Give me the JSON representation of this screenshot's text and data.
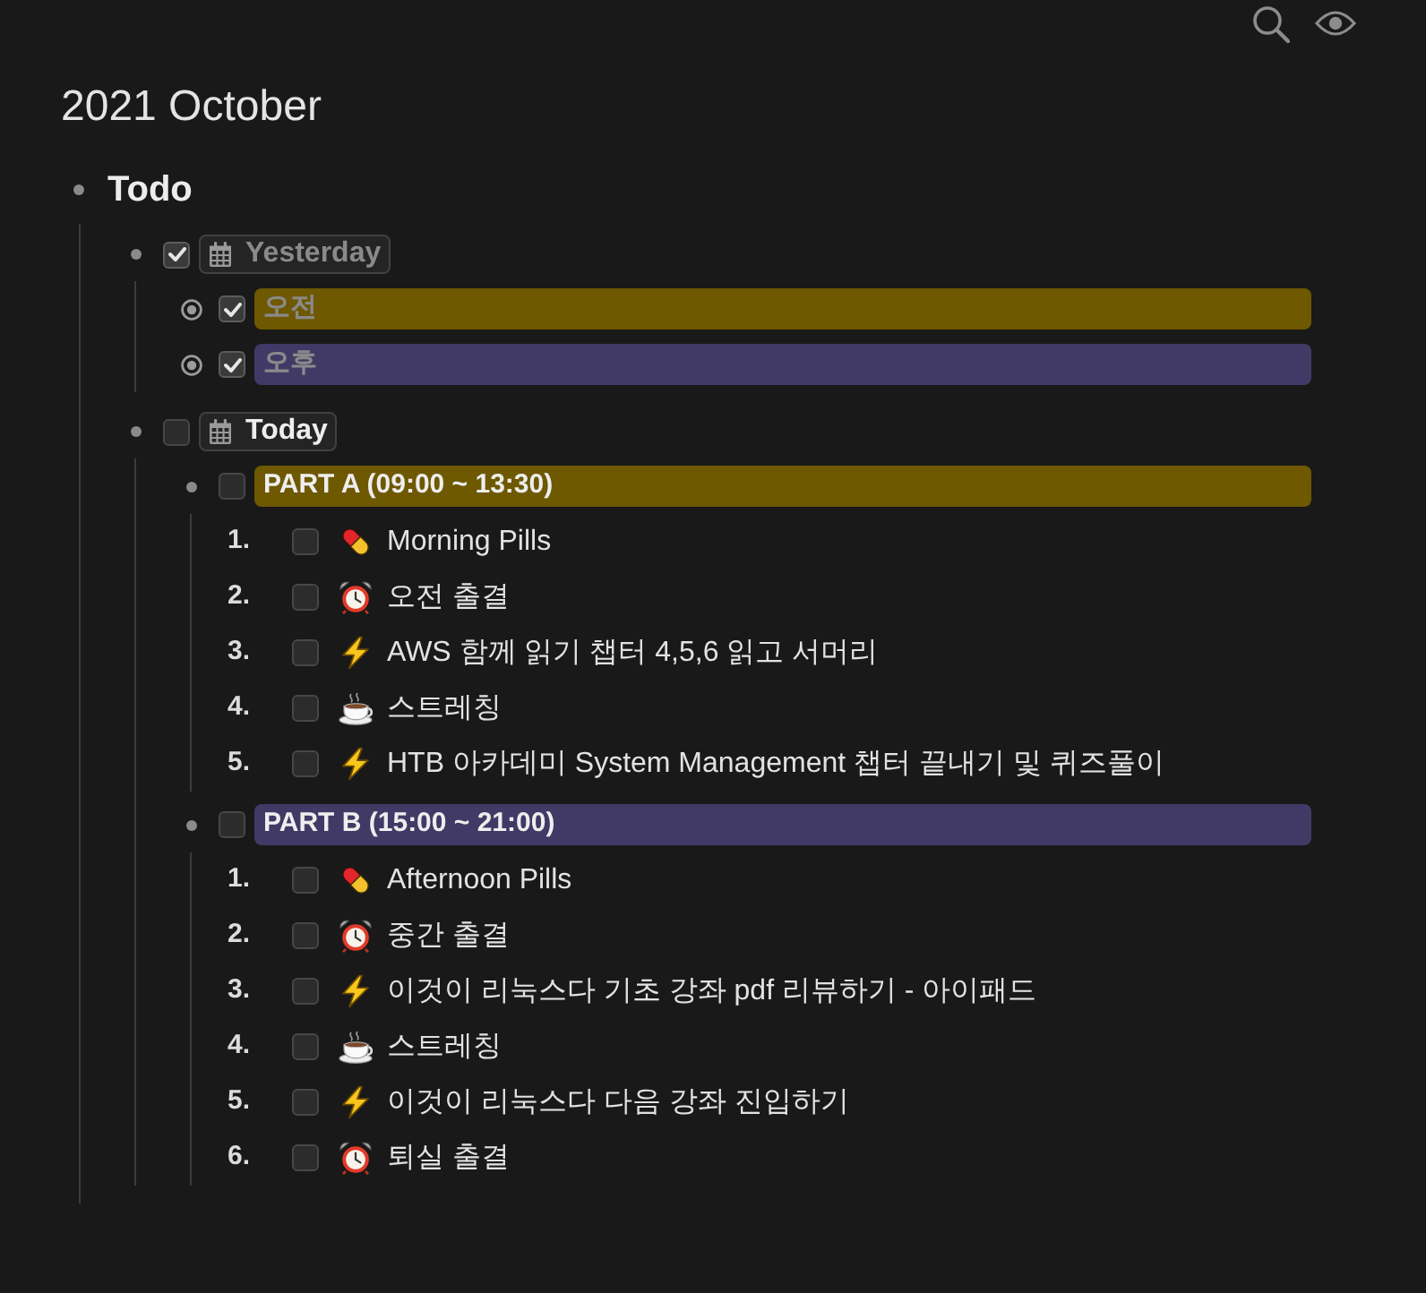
{
  "title": "2021 October",
  "outline": [
    {
      "kind": "heading",
      "text": "Todo",
      "collapsed": false,
      "children": [
        {
          "kind": "date",
          "text": "Yesterday",
          "checked": true,
          "collapsed": false,
          "children": [
            {
              "kind": "highlight",
              "text": "오전",
              "checked": true,
              "collapsed": true,
              "color": "#6e5800"
            },
            {
              "kind": "highlight",
              "text": "오후",
              "checked": true,
              "collapsed": true,
              "color": "#413a66"
            }
          ]
        },
        {
          "kind": "date",
          "text": "Today",
          "checked": false,
          "collapsed": false,
          "children": [
            {
              "kind": "highlight",
              "text": "PART A (09:00 ~ 13:30)",
              "checked": false,
              "collapsed": false,
              "color": "#6e5800",
              "tasks": [
                {
                  "number": "1.",
                  "kind": "medicine",
                  "text": "Morning Pills",
                  "checked": false
                },
                {
                  "number": "2.",
                  "kind": "attendance",
                  "text": "오전 출결",
                  "checked": false
                },
                {
                  "number": "3.",
                  "kind": "study",
                  "text": "AWS 함께 읽기 챕터 4,5,6 읽고 서머리",
                  "checked": false
                },
                {
                  "number": "4.",
                  "kind": "rest",
                  "text": "스트레칭",
                  "checked": false
                },
                {
                  "number": "5.",
                  "kind": "study",
                  "text": "HTB 아카데미 System Management 챕터 끝내기 및 퀴즈풀이",
                  "checked": false
                }
              ]
            },
            {
              "kind": "highlight",
              "text": "PART B (15:00 ~ 21:00)",
              "checked": false,
              "collapsed": false,
              "color": "#413a66",
              "tasks": [
                {
                  "number": "1.",
                  "kind": "medicine",
                  "text": "Afternoon Pills",
                  "checked": false
                },
                {
                  "number": "2.",
                  "kind": "attendance",
                  "text": "중간 출결",
                  "checked": false
                },
                {
                  "number": "3.",
                  "kind": "study",
                  "text": "이것이 리눅스다 기초 강좌 pdf 리뷰하기 - 아이패드",
                  "checked": false
                },
                {
                  "number": "4.",
                  "kind": "rest",
                  "text": "스트레칭",
                  "checked": false
                },
                {
                  "number": "5.",
                  "kind": "study",
                  "text": "이것이 리눅스다 다음 강좌 진입하기",
                  "checked": false
                },
                {
                  "number": "6.",
                  "kind": "attendance",
                  "text": "퇴실 출결",
                  "checked": false
                }
              ]
            }
          ]
        }
      ]
    }
  ]
}
